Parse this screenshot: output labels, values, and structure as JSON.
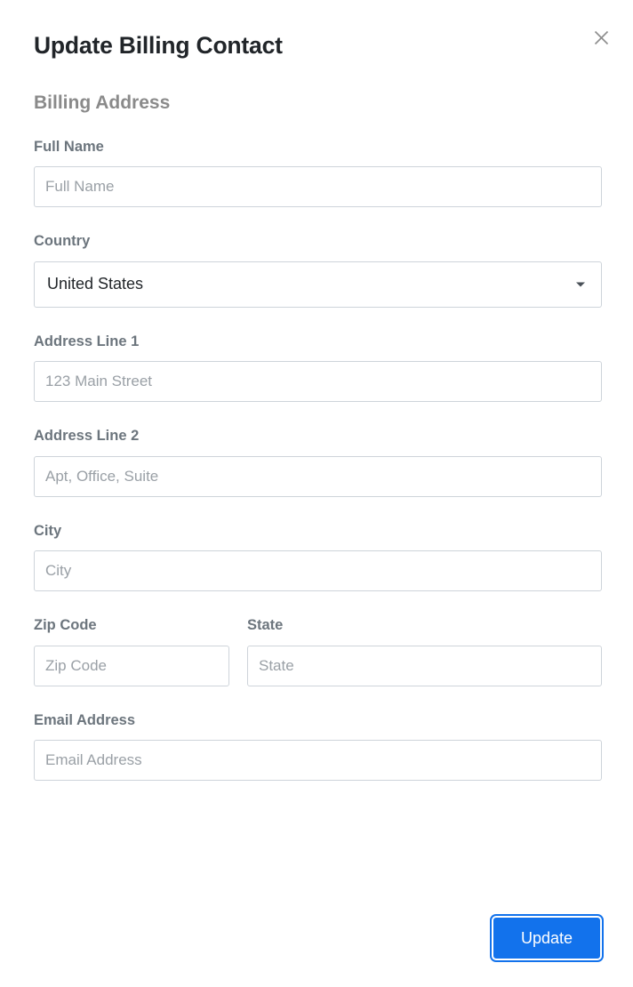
{
  "dialog": {
    "title": "Update Billing Contact",
    "close_icon": "close-icon",
    "section_heading": "Billing Address"
  },
  "form": {
    "full_name": {
      "label": "Full Name",
      "placeholder": "Full Name",
      "value": ""
    },
    "country": {
      "label": "Country",
      "selected": "United States",
      "caret_icon": "chevron-down-icon"
    },
    "address_line_1": {
      "label": "Address Line 1",
      "placeholder": "123 Main Street",
      "value": ""
    },
    "address_line_2": {
      "label": "Address Line 2",
      "placeholder": "Apt, Office, Suite",
      "value": ""
    },
    "city": {
      "label": "City",
      "placeholder": "City",
      "value": ""
    },
    "zip_code": {
      "label": "Zip Code",
      "placeholder": "Zip Code",
      "value": ""
    },
    "state": {
      "label": "State",
      "placeholder": "State",
      "value": ""
    },
    "email": {
      "label": "Email Address",
      "placeholder": "Email Address",
      "value": ""
    }
  },
  "footer": {
    "update_label": "Update"
  },
  "colors": {
    "accent": "#1272ec",
    "title_text": "#212529",
    "label_text": "#6c757d",
    "heading_text": "#8a8a8a",
    "placeholder_text": "#9aa0a6",
    "border": "#ced4da",
    "background": "#ffffff"
  }
}
